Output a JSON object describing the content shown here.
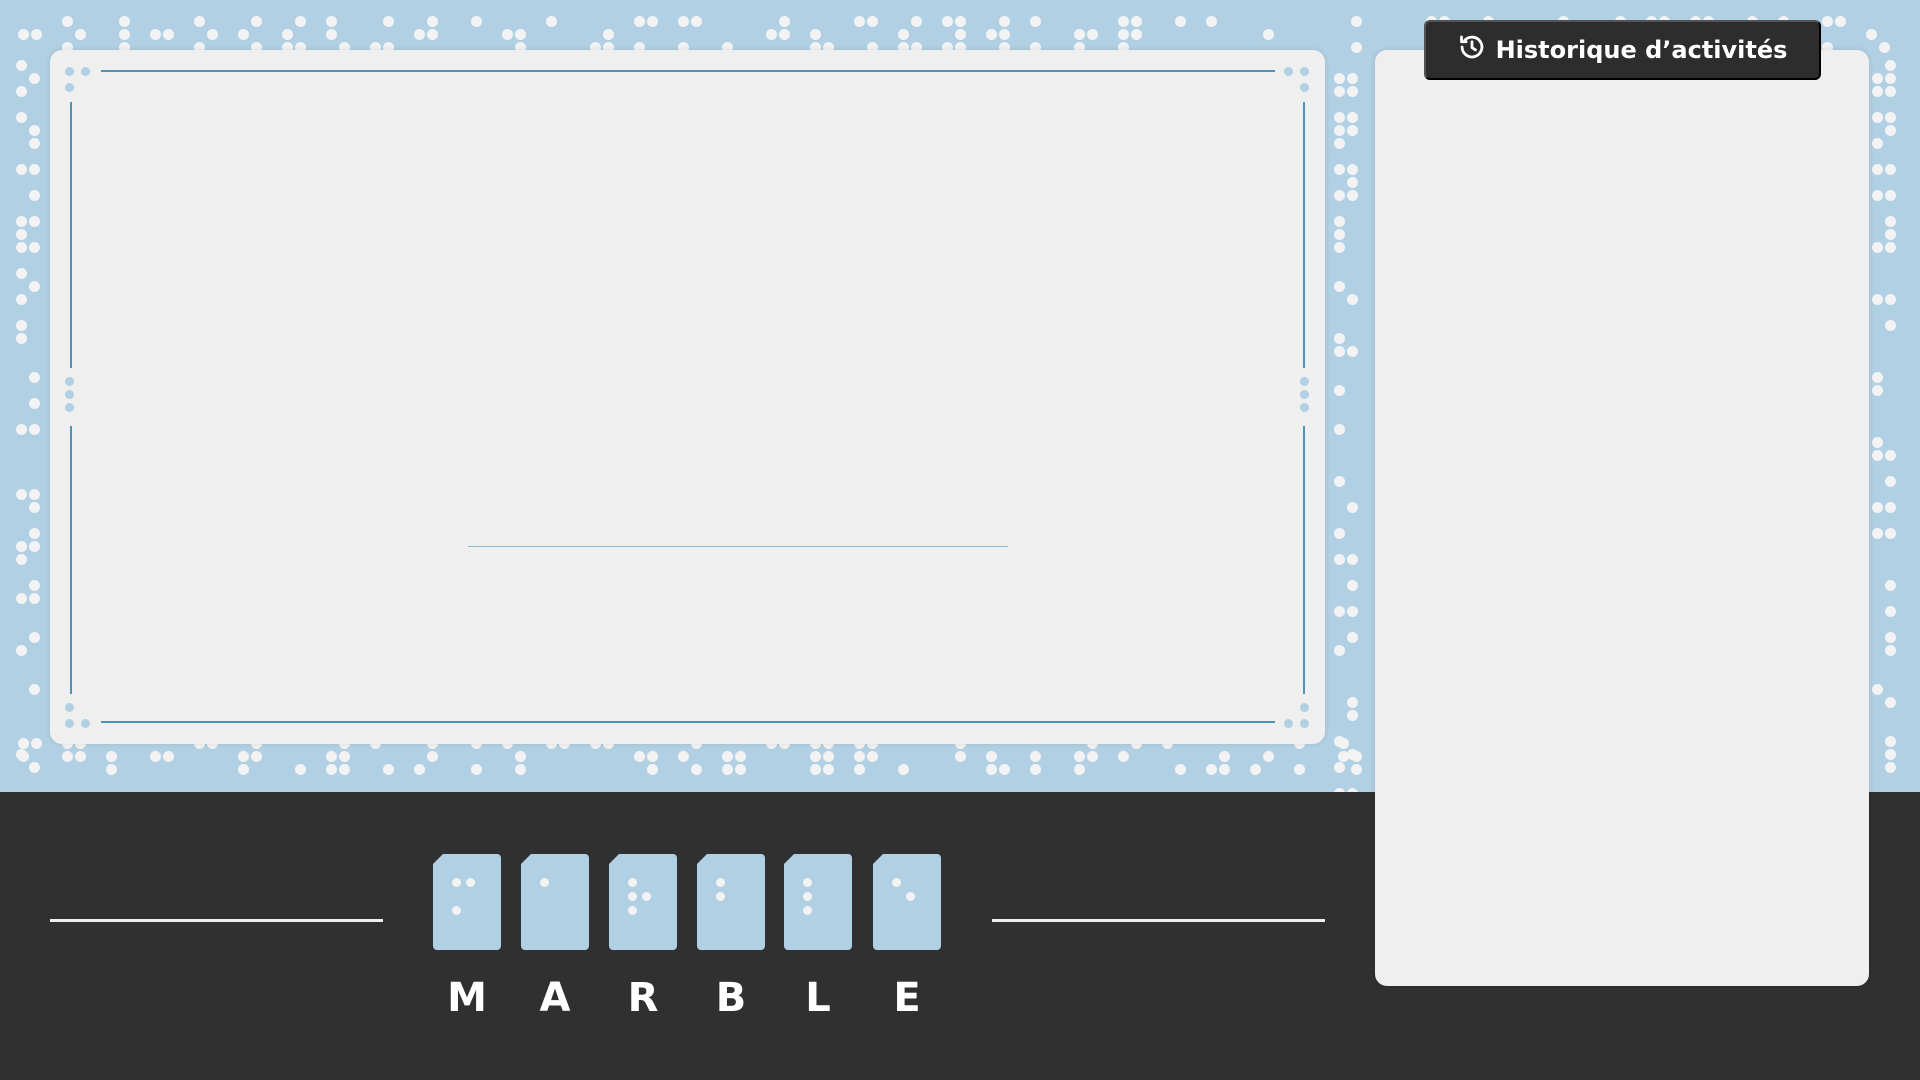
{
  "app": {
    "name": "Marble"
  },
  "history_panel": {
    "button_label": "Historique d’activités",
    "button_icon": "history-icon"
  },
  "brand": {
    "letters": [
      {
        "char": "M",
        "braille_dots": [
          1,
          3,
          4
        ]
      },
      {
        "char": "A",
        "braille_dots": [
          1
        ]
      },
      {
        "char": "R",
        "braille_dots": [
          1,
          2,
          3,
          5
        ]
      },
      {
        "char": "B",
        "braille_dots": [
          1,
          2
        ]
      },
      {
        "char": "L",
        "braille_dots": [
          1,
          2,
          3
        ]
      },
      {
        "char": "E",
        "braille_dots": [
          1,
          5
        ]
      }
    ]
  },
  "colors": {
    "background": "#b1d0e3",
    "panel": "#efefef",
    "footer": "#303030",
    "accent_line": "#4e94b6",
    "button": "#2d2d2d"
  }
}
